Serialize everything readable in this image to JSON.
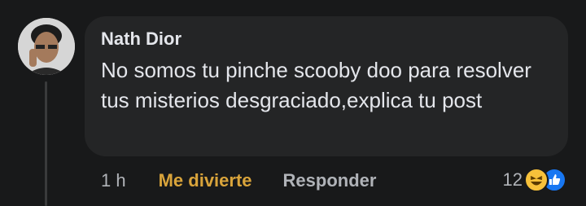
{
  "comment": {
    "author": "Nath Dior",
    "text": "No somos tu pinche scooby doo para resolver tus misterios desgraciado,explica tu post",
    "timestamp": "1 h",
    "reaction_label": "Me divierte",
    "reply_label": "Responder",
    "reaction_count": "12",
    "reaction_icons": [
      "haha-icon",
      "like-icon"
    ]
  },
  "colors": {
    "background": "#18191a",
    "bubble": "#242526",
    "text": "#e4e6eb",
    "muted": "#b0b3b8",
    "haha_accent": "#d9a43b",
    "like_blue": "#1877f2"
  }
}
